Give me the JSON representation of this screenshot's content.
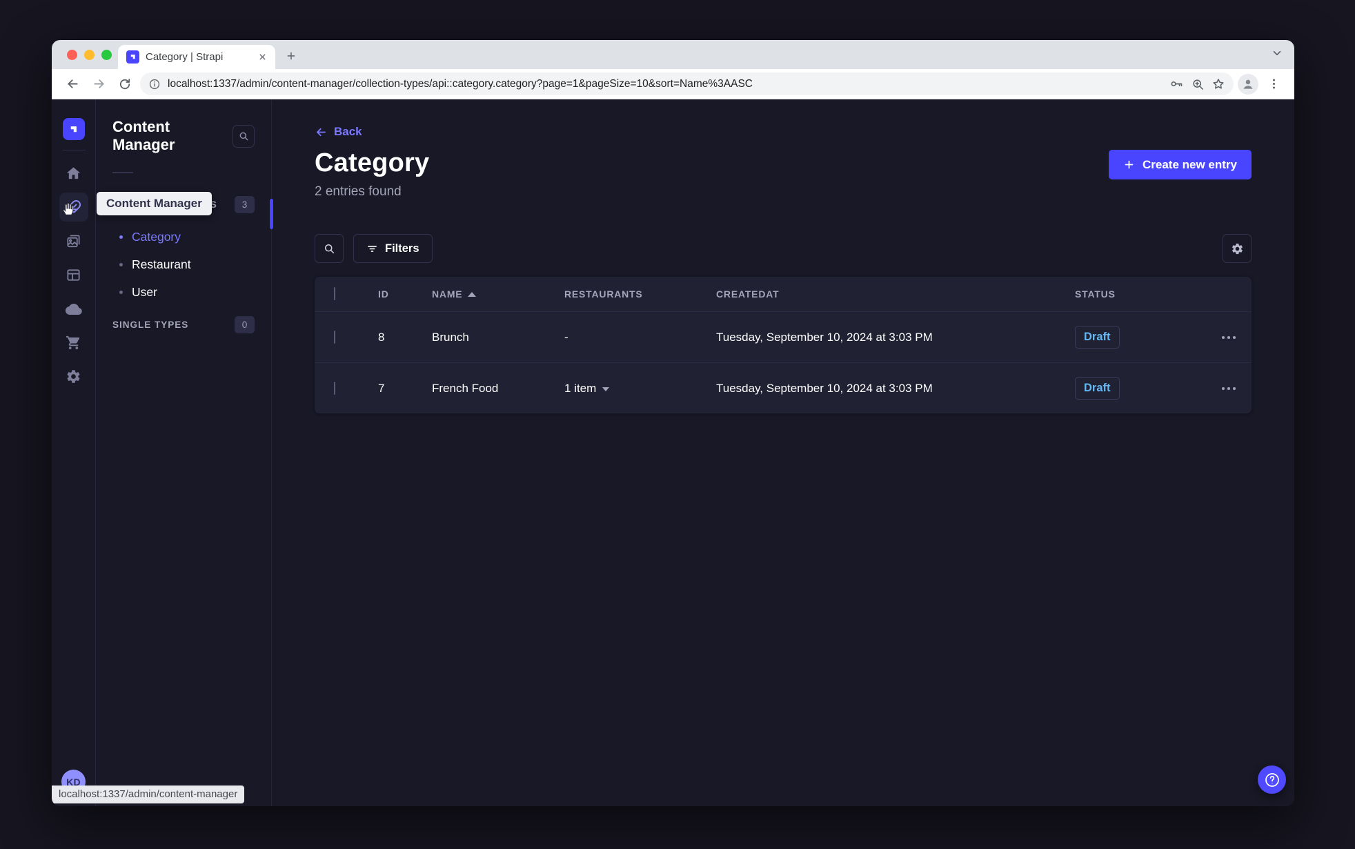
{
  "browser": {
    "tab_title": "Category | Strapi",
    "url": "localhost:1337/admin/content-manager/collection-types/api::category.category?page=1&pageSize=10&sort=Name%3AASC",
    "status_bar_text": "localhost:1337/admin/content-manager"
  },
  "sidebar": {
    "tooltip": "Content Manager",
    "avatar_initials": "KD"
  },
  "subnav": {
    "title": "Content Manager",
    "collection_types_label": "COLLECTION TYPES",
    "collection_types_count": "3",
    "items": [
      {
        "label": "Category"
      },
      {
        "label": "Restaurant"
      },
      {
        "label": "User"
      }
    ],
    "single_types_label": "SINGLE TYPES",
    "single_types_count": "0"
  },
  "header": {
    "back_label": "Back",
    "title": "Category",
    "subtitle": "2 entries found",
    "create_button_label": "Create new entry"
  },
  "toolbar": {
    "filters_label": "Filters"
  },
  "table": {
    "columns": {
      "id": "ID",
      "name": "NAME",
      "restaurants": "RESTAURANTS",
      "createdat": "CREATEDAT",
      "status": "STATUS"
    },
    "sorted_by": "NAME ascending",
    "rows": [
      {
        "id": "8",
        "name": "Brunch",
        "restaurants": "-",
        "createdat": "Tuesday, September 10, 2024 at 3:03 PM",
        "status": "Draft"
      },
      {
        "id": "7",
        "name": "French Food",
        "restaurants": "1 item",
        "createdat": "Tuesday, September 10, 2024 at 3:03 PM",
        "status": "Draft"
      }
    ]
  },
  "colors": {
    "primary": "#4945ff",
    "primary_light": "#7b79ff",
    "draft_status": "#66b7f1",
    "panel_bg": "#212134",
    "app_bg": "#181826"
  }
}
